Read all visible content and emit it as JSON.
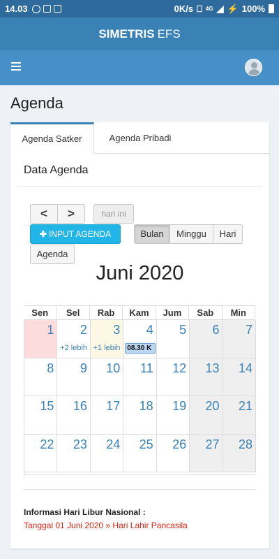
{
  "status_bar": {
    "time": "14.03",
    "network_speed": "0K/s",
    "signal": "4G",
    "battery": "100%"
  },
  "app": {
    "title_bold": "SIMETRIS",
    "title_light": "EFS"
  },
  "navbar": {
    "menu_icon": "hamburger-icon",
    "avatar_icon": "user-avatar-icon"
  },
  "page": {
    "title": "Agenda"
  },
  "tabs": [
    {
      "label": "Agenda Satker",
      "active": true
    },
    {
      "label": "Agenda Pribadi",
      "active": false
    }
  ],
  "section": {
    "title": "Data Agenda"
  },
  "toolbar": {
    "prev_label": "<",
    "next_label": ">",
    "today_label": "hari ini",
    "input_label": "INPUT AGENDA",
    "input_icon": "plus-icon",
    "view_month": "Bulan",
    "view_week": "Minggu",
    "view_day": "Hari",
    "view_agenda": "Agenda",
    "active_view": "Bulan"
  },
  "calendar": {
    "title": "Juni 2020",
    "weekdays": [
      "Sen",
      "Sel",
      "Rab",
      "Kam",
      "Jum",
      "Sab",
      "Min"
    ],
    "weeks": [
      [
        {
          "day": "1",
          "holiday": true
        },
        {
          "day": "2",
          "more": "+2 lebih"
        },
        {
          "day": "3",
          "today": true,
          "more": "+1 lebih"
        },
        {
          "day": "4",
          "event": "08.30 K"
        },
        {
          "day": "5"
        },
        {
          "day": "6",
          "weekend": true
        },
        {
          "day": "7",
          "weekend": true
        }
      ],
      [
        {
          "day": "8"
        },
        {
          "day": "9"
        },
        {
          "day": "10"
        },
        {
          "day": "11"
        },
        {
          "day": "12"
        },
        {
          "day": "13",
          "weekend": true
        },
        {
          "day": "14",
          "weekend": true
        }
      ],
      [
        {
          "day": "15"
        },
        {
          "day": "16"
        },
        {
          "day": "17"
        },
        {
          "day": "18"
        },
        {
          "day": "19"
        },
        {
          "day": "20",
          "weekend": true
        },
        {
          "day": "21",
          "weekend": true
        }
      ],
      [
        {
          "day": "22"
        },
        {
          "day": "23"
        },
        {
          "day": "24"
        },
        {
          "day": "25"
        },
        {
          "day": "26"
        },
        {
          "day": "27",
          "weekend": true
        },
        {
          "day": "28",
          "weekend": true
        }
      ]
    ]
  },
  "holidays": {
    "title": "Informasi Hari Libur Nasional :",
    "items": [
      "Tanggal 01 Juni 2020 » Hari Lahir Pancasila"
    ]
  },
  "colors": {
    "status_bar": "#2e6b9c",
    "app_bar": "#3a81b5",
    "nav_bar": "#4690c7",
    "primary_button": "#22b5e8",
    "holiday_text": "#d9230f",
    "holiday_cell": "#fcdcdc",
    "today_cell": "#fcf8e3",
    "event_chip": "#b9d5f2"
  }
}
